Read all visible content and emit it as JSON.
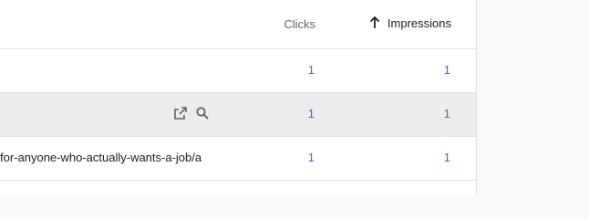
{
  "table": {
    "headers": {
      "clicks": "Clicks",
      "impressions": "Impressions",
      "sort_icon": "arrow-up-icon"
    },
    "rows": [
      {
        "url": "",
        "clicks": "1",
        "impressions": "1"
      },
      {
        "url": "",
        "clicks": "1",
        "impressions": "1",
        "hover_icons": [
          "open-in-new-icon",
          "search-icon"
        ]
      },
      {
        "url": "for-anyone-who-actually-wants-a-job/a",
        "clicks": "1",
        "impressions": "1"
      }
    ]
  },
  "colors": {
    "accent": "#1a73e8",
    "hover_row": "#ececec",
    "divider": "#e0e0e0"
  }
}
